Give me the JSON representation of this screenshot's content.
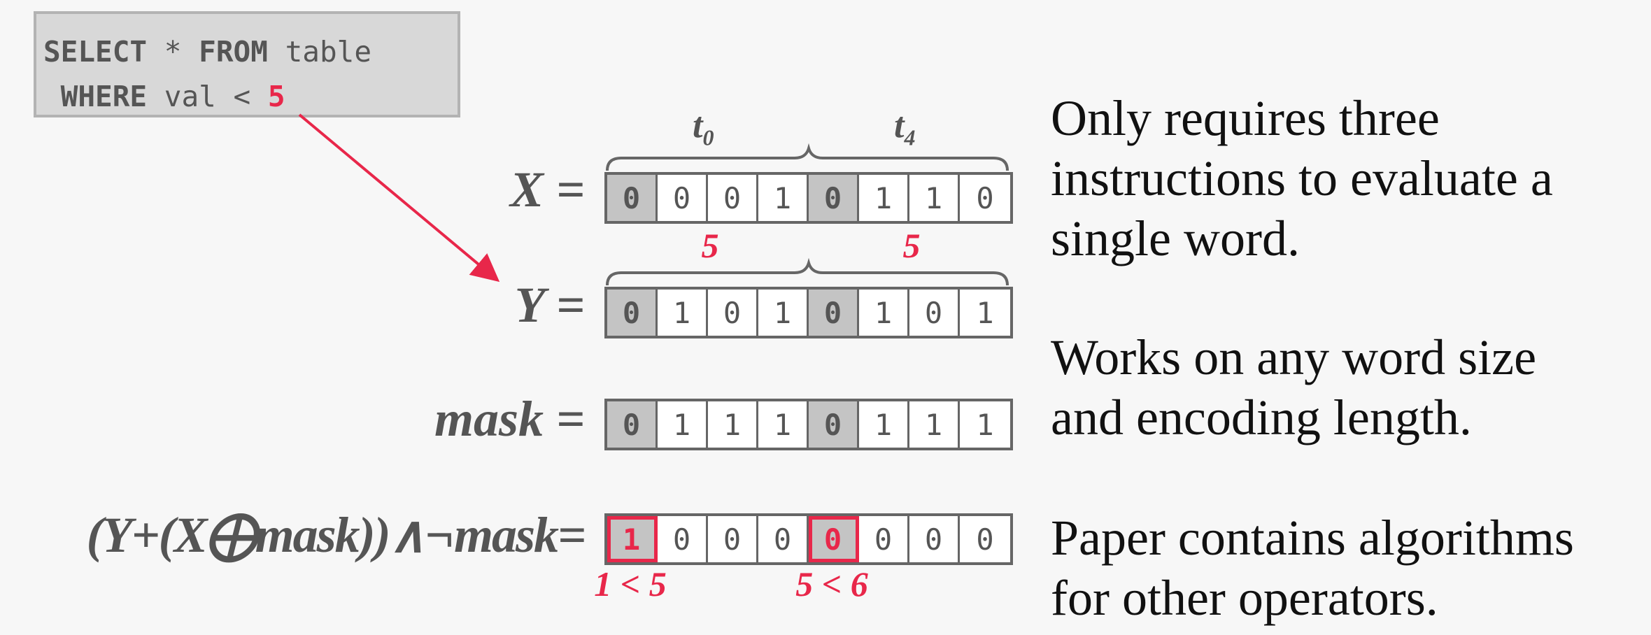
{
  "sql": {
    "line1": [
      "SELECT",
      " * ",
      "FROM",
      " table"
    ],
    "line2": [
      " WHERE",
      " val < ",
      "5"
    ]
  },
  "labels": {
    "x": "X =",
    "y": "Y =",
    "mask": "mask =",
    "result": "(Y+(X⨁mask))∧¬mask="
  },
  "tuples": {
    "t0_base": "t",
    "t0_sub": "0",
    "t4_base": "t",
    "t4_sub": "4"
  },
  "rows": {
    "x": [
      "0",
      "0",
      "0",
      "1",
      "0",
      "1",
      "1",
      "0"
    ],
    "y": [
      "0",
      "1",
      "0",
      "1",
      "0",
      "1",
      "0",
      "1"
    ],
    "mask": [
      "0",
      "1",
      "1",
      "1",
      "0",
      "1",
      "1",
      "1"
    ],
    "result": [
      "1",
      "0",
      "0",
      "0",
      "0",
      "0",
      "0",
      "0"
    ]
  },
  "y_annotations": [
    "5",
    "5"
  ],
  "result_annotations": [
    "1 < 5",
    "5 < 6"
  ],
  "notes": {
    "n1_line1": "Only requires three",
    "n1_line2": "instructions to evaluate a",
    "n1_line3": "single word.",
    "n2_line1": "Works on any word size",
    "n2_line2": "and encoding length.",
    "n3_line1": "Paper contains algorithms",
    "n3_line2": "for other operators."
  },
  "colors": {
    "accent": "#e8274a",
    "shade": "#c4c4c4",
    "stroke": "#666666"
  }
}
